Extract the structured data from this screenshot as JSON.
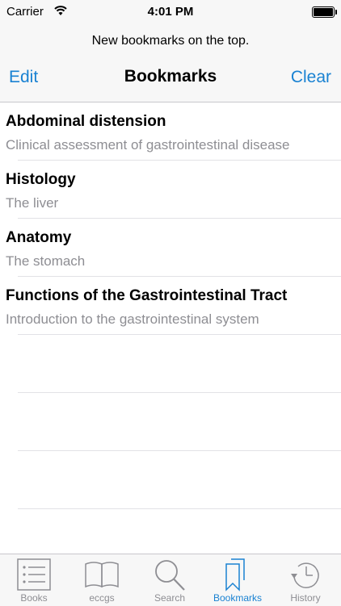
{
  "status": {
    "carrier": "Carrier",
    "time": "4:01 PM"
  },
  "nav": {
    "prompt": "New bookmarks on the top.",
    "edit_label": "Edit",
    "title": "Bookmarks",
    "clear_label": "Clear"
  },
  "bookmarks": [
    {
      "title": "Abdominal distension",
      "subtitle": "Clinical assessment of gastrointestinal disease"
    },
    {
      "title": "Histology",
      "subtitle": "The liver"
    },
    {
      "title": "Anatomy",
      "subtitle": "The stomach"
    },
    {
      "title": "Functions of the Gastrointestinal Tract",
      "subtitle": "Introduction to the gastrointestinal system"
    }
  ],
  "tabs": [
    {
      "label": "Books",
      "icon": "list-icon"
    },
    {
      "label": "eccgs",
      "icon": "open-book-icon"
    },
    {
      "label": "Search",
      "icon": "magnifier-icon"
    },
    {
      "label": "Bookmarks",
      "icon": "bookmarks-icon",
      "active": true
    },
    {
      "label": "History",
      "icon": "clock-icon"
    }
  ],
  "colors": {
    "accent": "#1a82d2",
    "inactive": "#8e8e93"
  }
}
